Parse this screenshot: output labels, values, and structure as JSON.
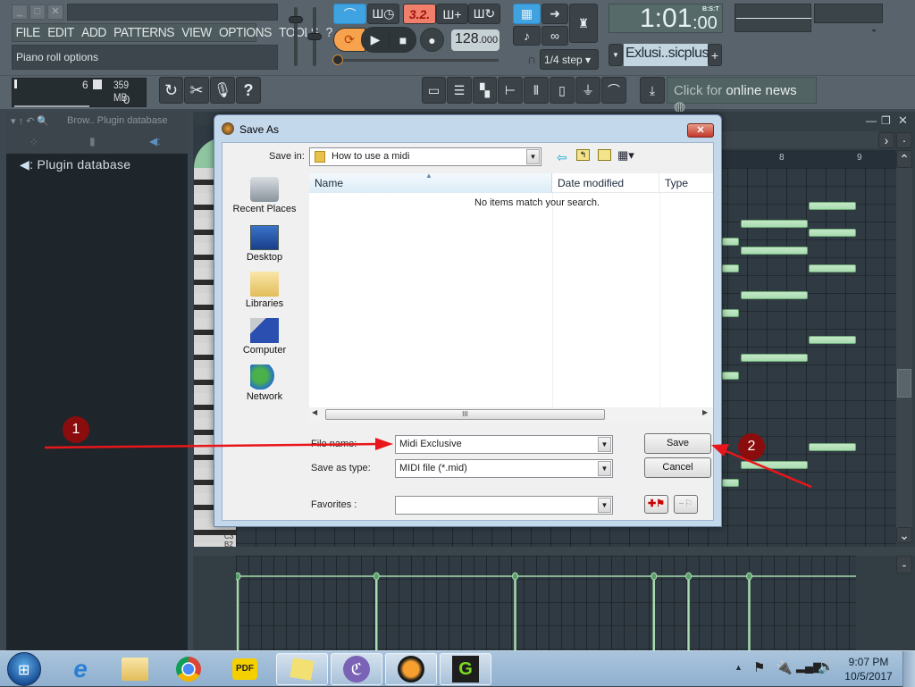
{
  "app": {
    "menu": [
      "FILE",
      "EDIT",
      "ADD",
      "PATTERNS",
      "VIEW",
      "OPTIONS",
      "TOOLS",
      "?"
    ],
    "hint_bar": "Piano roll options",
    "cpu_value": "6",
    "memory": "359 MB",
    "polyphony": "0",
    "pattern_number": "3.2.",
    "tempo": "128",
    "tempo_decimals": ".000",
    "time_display": "1:01",
    "time_display_ticks": ":00",
    "time_format": "B:S:T",
    "snap": "1/4 step",
    "pattern_selector": "Exlusi..sicplus",
    "news": {
      "prefix": "Click for ",
      "link": "online news"
    }
  },
  "browser": {
    "title": "Brow.. Plugin database",
    "item": "Plugin database"
  },
  "piano_roll": {
    "bar_labels": [
      "8",
      "9"
    ],
    "key_labels": [
      "C3",
      "B2"
    ],
    "note_color": "#a8dbb0",
    "velocity_positions": [
      0,
      0.25,
      0.5,
      0.75,
      0.8125,
      0.921875
    ]
  },
  "dialog": {
    "title": "Save As",
    "save_in_label": "Save in:",
    "save_in_value": "How to use a midi",
    "places": [
      "Recent Places",
      "Desktop",
      "Libraries",
      "Computer",
      "Network"
    ],
    "columns": [
      "Name",
      "Date modified",
      "Type"
    ],
    "empty_message": "No items match your search.",
    "file_name_label": "File name:",
    "file_name_value": "Midi Exclusive",
    "save_type_label": "Save as type:",
    "save_type_value": "MIDI file (*.mid)",
    "favorites_label": "Favorites :",
    "favorites_value": "",
    "save_button": "Save",
    "cancel_button": "Cancel"
  },
  "annotations": [
    {
      "number": "1",
      "target": "file-name-field"
    },
    {
      "number": "2",
      "target": "save-button"
    }
  ],
  "taskbar": {
    "apps": [
      "Internet Explorer",
      "Windows Explorer",
      "Google Chrome",
      "PDF Reader",
      "Sticky Notes",
      "BitTorrent",
      "FL Studio",
      "Camtasia"
    ],
    "time": "9:07 PM",
    "date": "10/5/2017"
  },
  "colors": {
    "accent_blue": "#3fa3e2",
    "note_green": "#a8dbb0",
    "annotation_red": "#8b0c0c",
    "arrow_red": "#e8161a"
  }
}
